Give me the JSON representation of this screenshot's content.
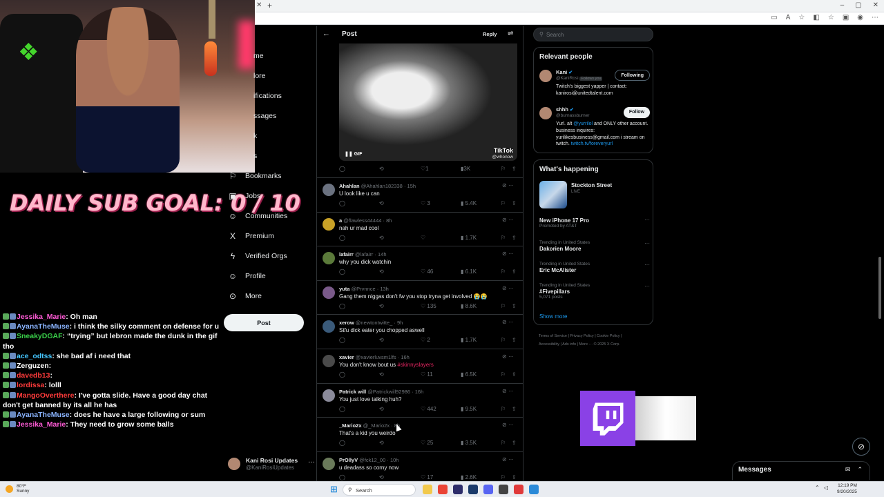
{
  "overlay": {
    "sub_goal": "DAILY SUB GOAL: 0 / 10",
    "chat": [
      {
        "user": "Jessika_Marie",
        "color": "#ff5bd6",
        "message": ": Oh man"
      },
      {
        "user": "AyanaTheMuse",
        "color": "#8ab4ff",
        "message": ": i think the silky comment on defense for u"
      },
      {
        "user": "SneakyDGAF",
        "color": "#3ad14a",
        "message": ": “trying” but lebron made the dunk in the gif tho"
      },
      {
        "user": "ace_odtss",
        "color": "#45c7ff",
        "message": ": she bad af i need that"
      },
      {
        "user": "Zerguzen",
        "color": "#ffffff",
        "message": ":"
      },
      {
        "user": "davedb13",
        "color": "#ff3b3b",
        "message": ":"
      },
      {
        "user": "lordissa",
        "color": "#ff3b3b",
        "message": ": lolll"
      },
      {
        "user": "MangoOverthere",
        "color": "#ff3b3b",
        "message": ": I've gotta slide. Have a good day chat don't get banned by its all he has"
      },
      {
        "user": "AyanaTheMuse",
        "color": "#8ab4ff",
        "message": ": does he have a large following or sum"
      },
      {
        "user": "Jessika_Marie",
        "color": "#ff5bd6",
        "message": ": They need to grow some balls"
      }
    ]
  },
  "nav": {
    "partial_items": [
      "me",
      "lore",
      "ifications",
      "ssages",
      "k",
      "s"
    ],
    "items": [
      {
        "label": "Bookmarks",
        "icon": "bookmark-icon",
        "glyph": "⚐"
      },
      {
        "label": "Jobs",
        "icon": "briefcase-icon",
        "glyph": "▣"
      },
      {
        "label": "Communities",
        "icon": "communities-icon",
        "glyph": "☺"
      },
      {
        "label": "Premium",
        "icon": "x-logo-icon",
        "glyph": "X"
      },
      {
        "label": "Verified Orgs",
        "icon": "lightning-icon",
        "glyph": "ϟ"
      },
      {
        "label": "Profile",
        "icon": "person-icon",
        "glyph": "☺"
      },
      {
        "label": "More",
        "icon": "more-circle-icon",
        "glyph": "⊙"
      }
    ],
    "post_label": "Post",
    "account_name": "Kani Rosi Updates",
    "account_handle": "@KaniRosiUpdates"
  },
  "post": {
    "title": "Post",
    "reply_label": "Reply",
    "media_badge": "GIF",
    "tiktok": "TikTok",
    "tiktok_user": "@whonow",
    "actions": {
      "likes": "1",
      "views": "3K"
    }
  },
  "replies": [
    {
      "name": "Ahahlan",
      "handle": "@Ahahlan182338",
      "time": "15h",
      "text": "U look like u can",
      "likes": "3",
      "views": "5.4K",
      "avatar": "#6b7280"
    },
    {
      "name": "a",
      "handle": "@flawless44444",
      "time": "8h",
      "text": "nah ur mad cool",
      "likes": "",
      "views": "1.7K",
      "avatar": "#c9a227"
    },
    {
      "name": "lafairr",
      "handle": "@lafairr",
      "time": "14h",
      "text": "why you dick watchin",
      "likes": "46",
      "views": "6.1K",
      "avatar": "#5b7a3a"
    },
    {
      "name": "yuta",
      "handle": "@Prvnnce",
      "time": "13h",
      "text": "Gang them niggas don't fw you stop tryna get involved 😭😭",
      "likes": "135",
      "views": "8.6K",
      "avatar": "#7a5a8a"
    },
    {
      "name": "xerow",
      "handle": "@newtontwitte_",
      "time": "9h",
      "text": "Stfu dick eater you chopped aswell",
      "likes": "2",
      "views": "1.7K",
      "avatar": "#3a5a7a"
    },
    {
      "name": "xavier",
      "handle": "@xavierluvsm1lfs",
      "time": "16h",
      "text_pre": "You don't know bout us ",
      "text_hl": "#skinnyslayers",
      "likes": "11",
      "views": "6.5K",
      "avatar": "#4a4a4a"
    },
    {
      "name": "Patrick will",
      "handle": "@Patrickwill92986",
      "time": "16h",
      "text": "You just love talking huh?",
      "likes": "442",
      "views": "9.5K",
      "avatar": "#8a8a9a"
    },
    {
      "name": "_Mario2x",
      "handle": "@_Mario2x",
      "time": "8h",
      "text": "That's a kid you weirdo",
      "likes": "25",
      "views": "3.5K",
      "avatar": "#000000"
    },
    {
      "name": "PrOllyV",
      "handle": "@fck12_00",
      "time": "10h",
      "text": "u deadass so corny now",
      "likes": "17",
      "views": "2.6K",
      "avatar": "#6a7a5a"
    }
  ],
  "right": {
    "search_placeholder": "Search",
    "relevant_title": "Relevant people",
    "people": [
      {
        "name": "Kani",
        "handle": "@KaniRosi",
        "follows_you": "Follows you",
        "button": "Following",
        "bio_parts": [
          {
            "t": "Twitch's biggest yapper | contact: kanirosi@unitedtalent.com",
            "link": false
          }
        ]
      },
      {
        "name": "shhh",
        "handle": "@burnassburner",
        "follows_you": "",
        "button": "Follow",
        "bio_parts": [
          {
            "t": "Yurl. alt ",
            "link": false
          },
          {
            "t": "@yurrilol",
            "link": true
          },
          {
            "t": " and ONLY other account. business inquires: yurilikesbusiness@gmail.com i stream on twitch. ",
            "link": false
          },
          {
            "t": "twitch.tv/foreveryurl",
            "link": true
          }
        ]
      }
    ],
    "happening_title": "What's happening",
    "live": {
      "title": "Stockton Street",
      "status": "LIVE"
    },
    "trends": [
      {
        "category": "",
        "title": "New iPhone 17 Pro",
        "sub": "Promoted by AT&T"
      },
      {
        "category": "Trending in United States",
        "title": "Dakorien Moore",
        "sub": ""
      },
      {
        "category": "Trending in United States",
        "title": "Eric McAlister",
        "sub": ""
      },
      {
        "category": "Trending in United States",
        "title": "#Fivepillars",
        "sub": "5,071 posts"
      }
    ],
    "show_more": "Show more",
    "footer_line1": "Terms of Service  |  Privacy Policy  |  Cookie Policy  |",
    "footer_line2": "Accessibility  |  Ads info  |  More ···  © 2025 X Corp."
  },
  "messages_label": "Messages",
  "taskbar": {
    "temp": "80°F",
    "condition": "Sunny",
    "search": "Search",
    "time": "12:19 PM",
    "date": "9/20/2025"
  }
}
